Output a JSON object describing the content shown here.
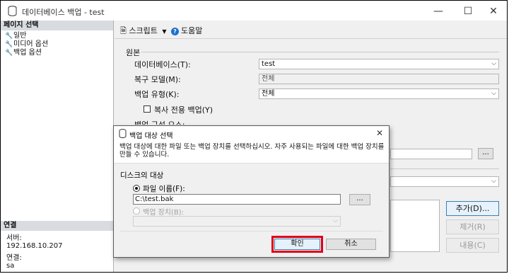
{
  "window": {
    "title": "데이터베이스 백업 - test",
    "controls": {
      "minimize": "—",
      "maximize": "☐",
      "close": "✕"
    }
  },
  "left_pane": {
    "header": "페이지 선택",
    "items": [
      {
        "label": "일반",
        "icon": "wrench-icon"
      },
      {
        "label": "미디어 옵션",
        "icon": "wrench-icon"
      },
      {
        "label": "백업 옵션",
        "icon": "wrench-icon"
      }
    ],
    "connection": {
      "header": "연결",
      "server_label": "서버:",
      "server_value": "192.168.10.207",
      "connection_label": "연결:",
      "connection_value": "sa"
    }
  },
  "toolbar": {
    "script_label": "스크립트",
    "help_label": "도움말"
  },
  "main": {
    "source_group": "원본",
    "database_label": "데이터베이스(T):",
    "database_value": "test",
    "recovery_label": "복구 모델(M):",
    "recovery_value": "전체",
    "backup_type_label": "백업 유형(K):",
    "backup_type_value": "전체",
    "copy_only_label": "복사 전용 백업(Y)",
    "backup_component_partial": "백업 구성 요소:",
    "ellipsis": "...",
    "add_button": "추가(D)...",
    "remove_button": "제거(R)",
    "contents_button": "내용(C)"
  },
  "dialog": {
    "title": "백업 대상 선택",
    "description": "백업 대상에 대한 파일 또는 백업 장치를 선택하십시오. 자주 사용되는 파일에 대한 백업 장치를 만들 수 있습니다.",
    "disk_target_label": "디스크의 대상",
    "file_name_label": "파일 이름(F):",
    "file_name_value": "C:\\test.bak",
    "browse_button": "...",
    "backup_device_label": "백업 장치(B):",
    "ok_button": "확인",
    "cancel_button": "취소",
    "close": "✕"
  }
}
